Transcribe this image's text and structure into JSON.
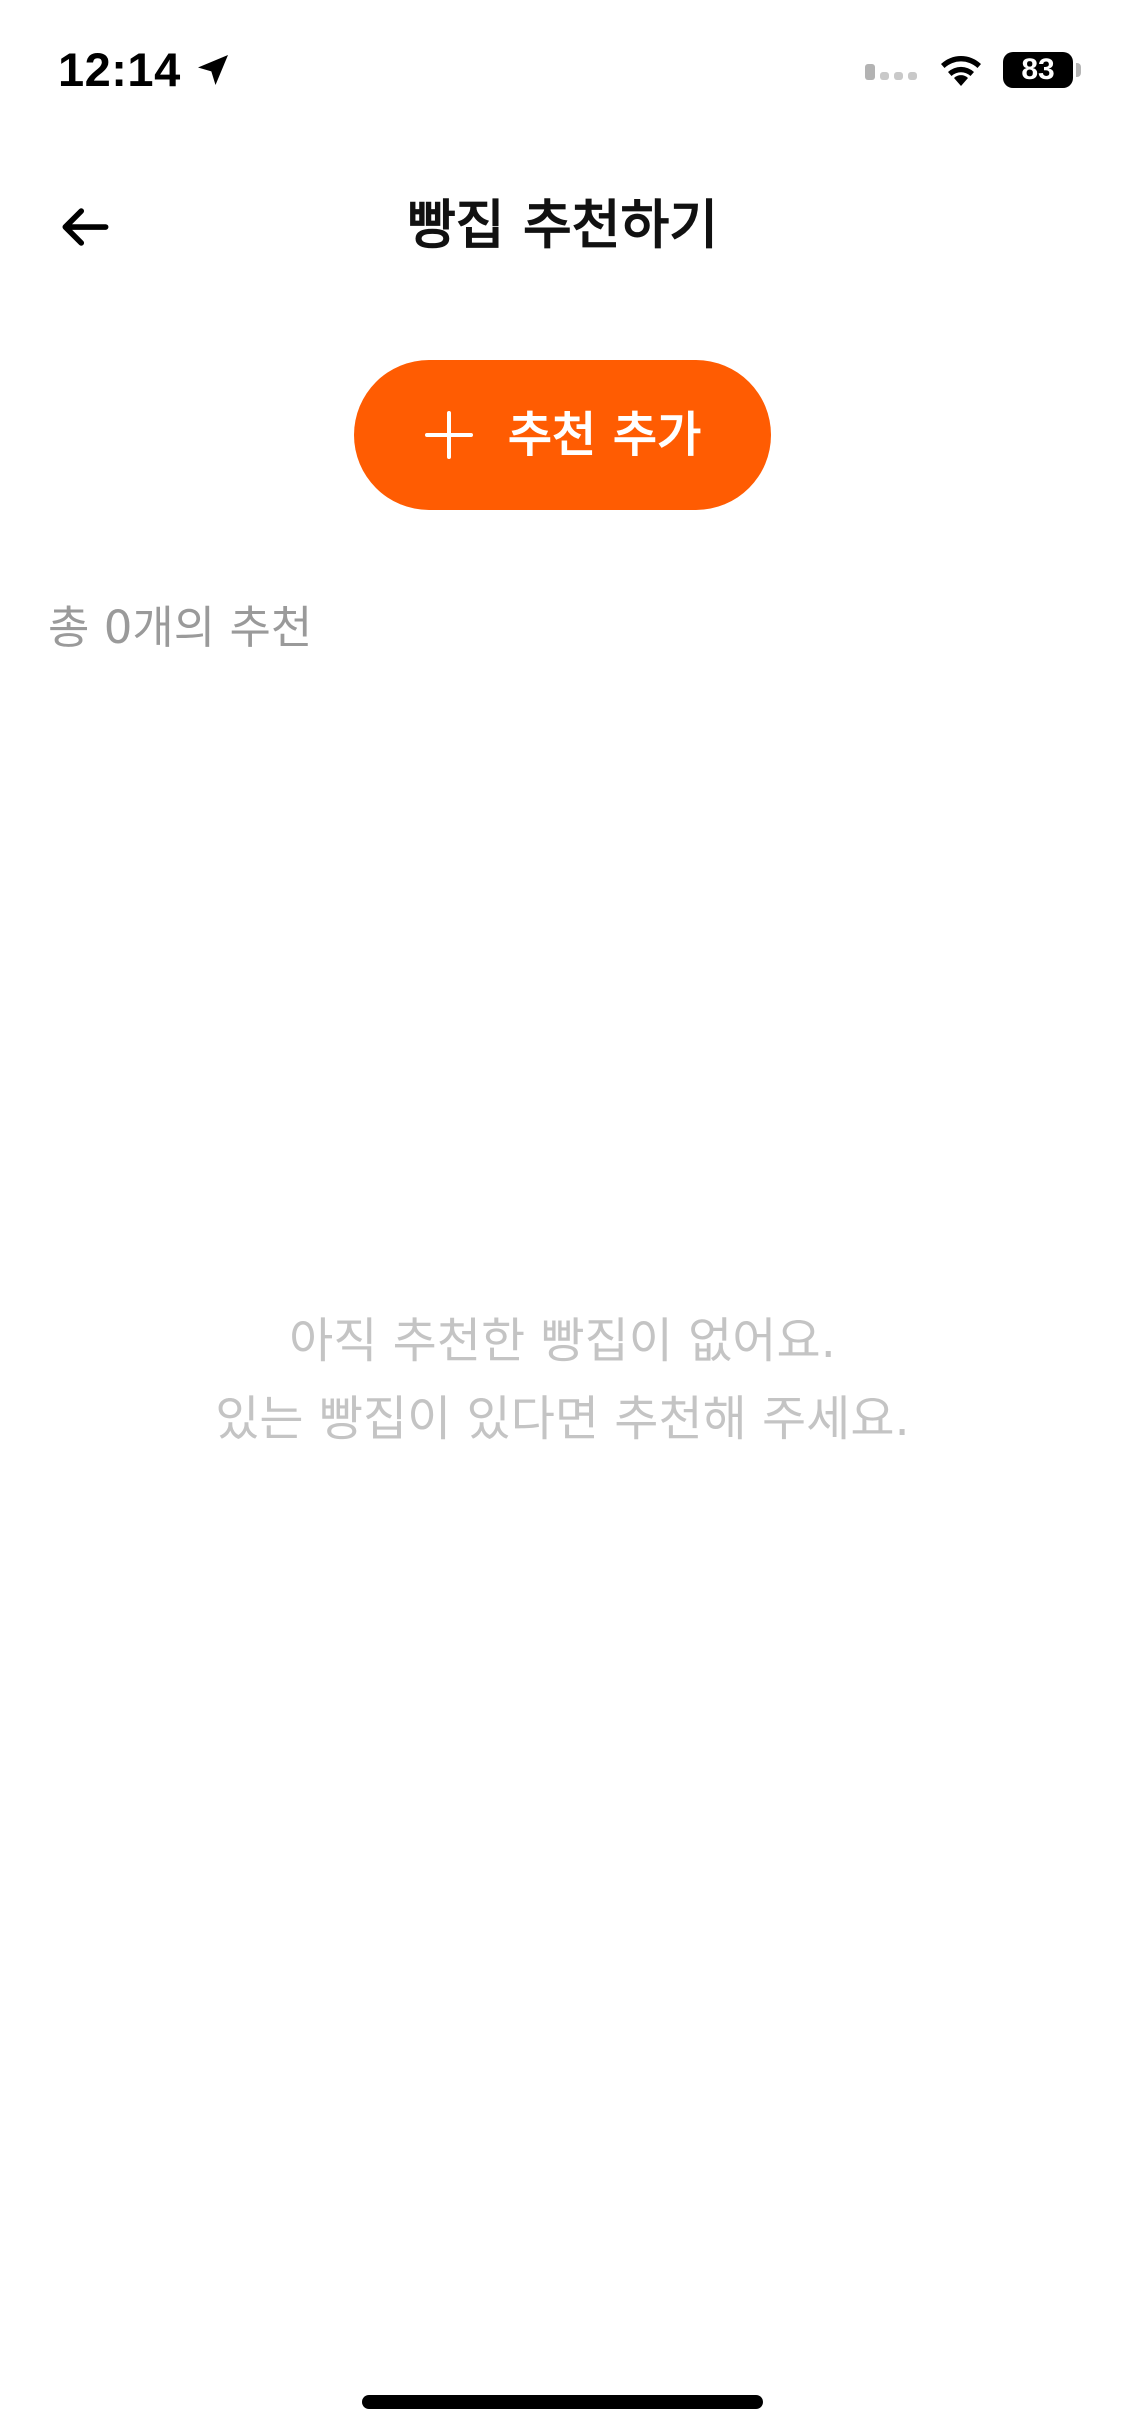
{
  "status_bar": {
    "time": "12:14",
    "battery": "83",
    "icons": [
      "location-arrow-icon",
      "cellular-signal-icon",
      "wifi-icon",
      "battery-icon"
    ]
  },
  "nav": {
    "title": "빵집 추천하기",
    "back_icon": "arrow-left-icon"
  },
  "add_button": {
    "label": "추천 추가",
    "icon": "plus-icon",
    "color": "#ff5c02"
  },
  "summary": {
    "count_text": "총 0개의 추천"
  },
  "empty_state": {
    "line1": "아직 추천한 빵집이 없어요.",
    "line2": "있는 빵집이 있다면 추천해 주세요."
  }
}
